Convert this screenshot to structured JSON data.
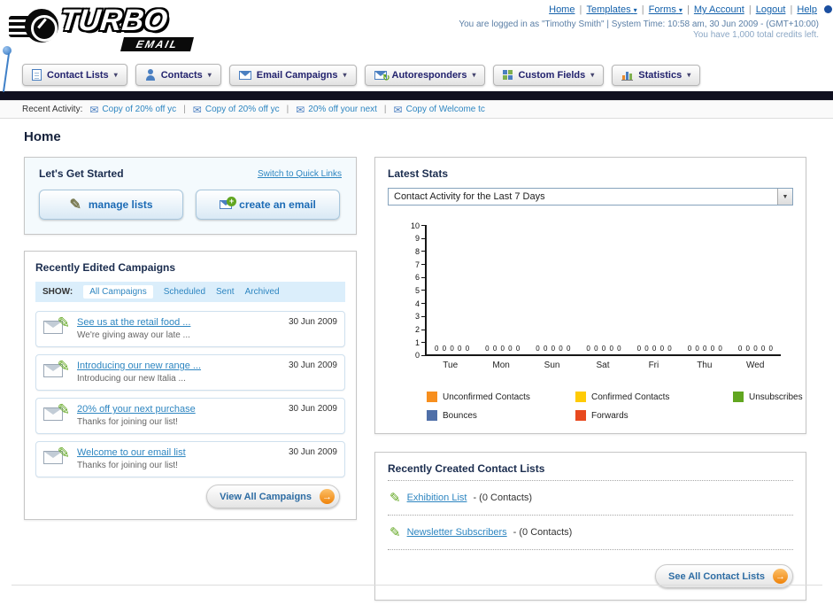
{
  "icons": {
    "dropdown_arrow": "▾",
    "select_arrow": "▼",
    "envelope": "✉",
    "pencil": "✎",
    "plus": "+",
    "arrow_right": "→",
    "refresh": "↻"
  },
  "separator": "|",
  "header": {
    "logo_primary": "TURBO",
    "logo_secondary": "EMAIL",
    "nav": [
      {
        "label": "Home",
        "arrow": ""
      },
      {
        "label": "Templates",
        "arrow": "▾"
      },
      {
        "label": "Forms",
        "arrow": "▾"
      },
      {
        "label": "My Account",
        "arrow": ""
      },
      {
        "label": "Logout",
        "arrow": ""
      },
      {
        "label": "Help",
        "arrow": ""
      }
    ],
    "login_line": "You are logged in as \"Timothy Smith\" | System Time: 10:58 am, 30 Jun 2009 - (GMT+10:00)",
    "credits_line": "You have 1,000 total credits left."
  },
  "nav_tabs": [
    {
      "label": "Contact Lists"
    },
    {
      "label": "Contacts"
    },
    {
      "label": "Email Campaigns"
    },
    {
      "label": "Autoresponders"
    },
    {
      "label": "Custom Fields"
    },
    {
      "label": "Statistics"
    }
  ],
  "recent_activity": {
    "label": "Recent Activity:",
    "items": [
      "Copy of 20% off yc",
      "Copy of 20% off yc",
      "20% off your next",
      "Copy of Welcome tc"
    ]
  },
  "page": {
    "title": "Home"
  },
  "get_started": {
    "title": "Let's Get Started",
    "switch_link": "Switch to Quick Links",
    "manage_lists_label": "manage lists",
    "create_email_label": "create an email"
  },
  "campaigns": {
    "title": "Recently Edited Campaigns",
    "show_label": "SHOW:",
    "filters": [
      "All Campaigns",
      "Scheduled",
      "Sent",
      "Archived"
    ],
    "selected_filter": "All Campaigns",
    "items": [
      {
        "title": "See us at the retail food ...",
        "subtitle": "We're giving away our late ...",
        "date": "30 Jun 2009"
      },
      {
        "title": "Introducing our new range ...",
        "subtitle": "Introducing our new Italia ...",
        "date": "30 Jun 2009"
      },
      {
        "title": "20% off your next purchase",
        "subtitle": "Thanks for joining our list!",
        "date": "30 Jun 2009"
      },
      {
        "title": "Welcome to our email list",
        "subtitle": "Thanks for joining our list!",
        "date": "30 Jun 2009"
      }
    ],
    "view_all_label": "View All Campaigns"
  },
  "stats": {
    "title": "Latest Stats",
    "period_selected": "Contact Activity for the Last 7 Days"
  },
  "chart_data": {
    "type": "bar",
    "title": "Contact Activity for the Last 7 Days",
    "categories": [
      "Tue",
      "Mon",
      "Sun",
      "Sat",
      "Fri",
      "Thu",
      "Wed"
    ],
    "series": [
      {
        "name": "Unconfirmed Contacts",
        "color": "#f78f1e",
        "values": [
          0,
          0,
          0,
          0,
          0,
          0,
          0
        ]
      },
      {
        "name": "Confirmed Contacts",
        "color": "#ffcb05",
        "values": [
          0,
          0,
          0,
          0,
          0,
          0,
          0
        ]
      },
      {
        "name": "Unsubscribes",
        "color": "#61a620",
        "values": [
          0,
          0,
          0,
          0,
          0,
          0,
          0
        ]
      },
      {
        "name": "Bounces",
        "color": "#4f6fa8",
        "values": [
          0,
          0,
          0,
          0,
          0,
          0,
          0
        ]
      },
      {
        "name": "Forwards",
        "color": "#e8491f",
        "values": [
          0,
          0,
          0,
          0,
          0,
          0,
          0
        ]
      }
    ],
    "ylim": [
      0,
      10
    ],
    "ytick_step": 1,
    "grid": false,
    "legend_position": "bottom"
  },
  "contact_lists": {
    "title": "Recently Created Contact Lists",
    "items": [
      {
        "name": "Exhibition List",
        "suffix": "- (0 Contacts)"
      },
      {
        "name": "Newsletter Subscribers",
        "suffix": "- (0 Contacts)"
      }
    ],
    "see_all_label": "See All Contact Lists"
  }
}
